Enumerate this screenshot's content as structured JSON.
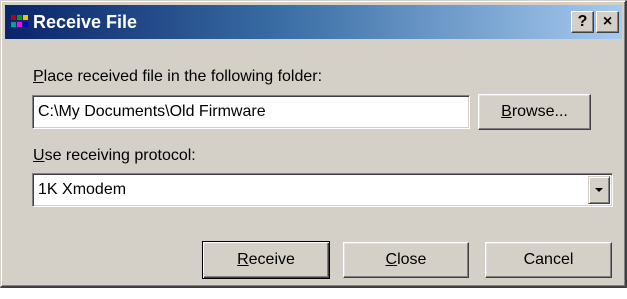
{
  "window": {
    "title": "Receive File",
    "help_glyph": "?",
    "close_glyph": "×",
    "app_icon": "terminal-app-icon"
  },
  "folder": {
    "label_acc": "P",
    "label_rest": "lace received file in the following folder:",
    "value": "C:\\My Documents\\Old Firmware",
    "browse_acc": "B",
    "browse_rest": "rowse..."
  },
  "protocol": {
    "label_acc": "U",
    "label_rest": "se receiving protocol:",
    "selected": "1K Xmodem"
  },
  "buttons": {
    "receive_acc": "R",
    "receive_rest": "eceive",
    "close_acc": "C",
    "close_rest": "lose",
    "cancel_label": "Cancel"
  }
}
